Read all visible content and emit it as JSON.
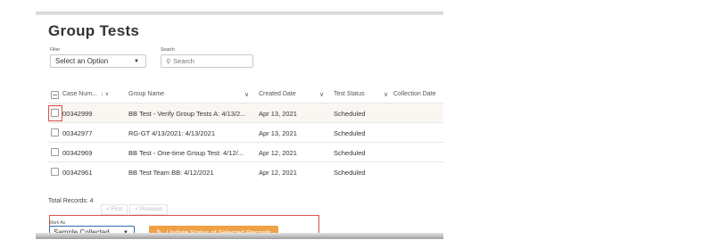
{
  "page": {
    "title": "Group Tests"
  },
  "filter": {
    "label": "Filter",
    "value": "Select an Option"
  },
  "search": {
    "label": "Search",
    "placeholder": "Search"
  },
  "table": {
    "columns": {
      "case_number": "Case Num...",
      "group_name": "Group Name",
      "created_date": "Created Date",
      "test_status": "Test Status",
      "collection_date": "Collection Date"
    },
    "rows": [
      {
        "case_number": "00342999",
        "group_name": "BB Test - Verify Group Tests A: 4/13/2...",
        "created_date": "Apr 13, 2021",
        "test_status": "Scheduled"
      },
      {
        "case_number": "00342977",
        "group_name": "RG-GT 4/13/2021: 4/13/2021",
        "created_date": "Apr 13, 2021",
        "test_status": "Scheduled"
      },
      {
        "case_number": "00342969",
        "group_name": "BB Test - One-time Group Test: 4/12/...",
        "created_date": "Apr 12, 2021",
        "test_status": "Scheduled"
      },
      {
        "case_number": "00342961",
        "group_name": "BB Test Team BB: 4/12/2021",
        "created_date": "Apr 12, 2021",
        "test_status": "Scheduled"
      }
    ]
  },
  "footer": {
    "total_records": "Total Records: 4",
    "first_label": "< First",
    "previous_label": "< Previous"
  },
  "mark_as": {
    "label": "Mark As",
    "value": "Sample Collected",
    "update_button": "Update Status of Selected Records"
  },
  "colors": {
    "accent_orange": "#f0a045",
    "highlight_red": "#d9534f",
    "select_focus_blue": "#2f6db5"
  },
  "icons": {
    "search": "search-icon",
    "pencil": "pencil-icon",
    "sort_down": "arrow-down-icon",
    "chevron": "chevron-down-icon"
  }
}
